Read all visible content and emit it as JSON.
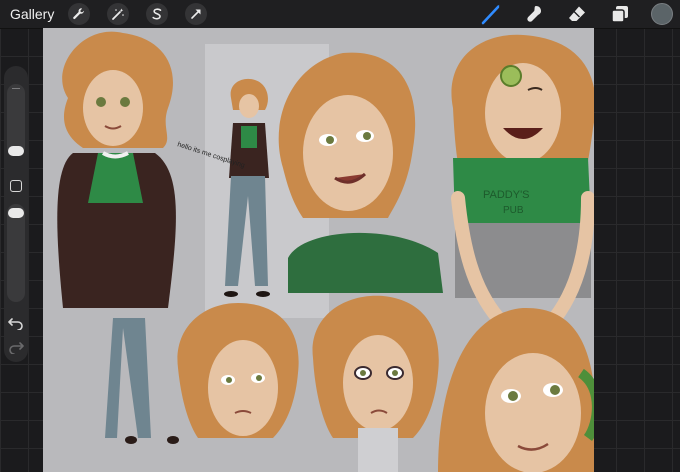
{
  "topbar": {
    "gallery_label": "Gallery",
    "left_tools": [
      {
        "icon": "wrench-icon"
      },
      {
        "icon": "magic-wand-icon"
      },
      {
        "icon": "selection-s-icon"
      },
      {
        "icon": "transform-arrow-icon"
      }
    ],
    "right_tools": [
      {
        "icon": "brush-icon",
        "active": true
      },
      {
        "icon": "smudge-icon"
      },
      {
        "icon": "eraser-icon"
      },
      {
        "icon": "layers-icon"
      }
    ],
    "current_color": "#5b6468"
  },
  "canvas": {
    "background": "#b9b9bc",
    "handwritten_note": "hello its me cosplaying"
  },
  "colors": {
    "hair": "#c98a4b",
    "skin": "#e6c4a4",
    "shirt": "#2e8a46",
    "jacket": "#3a2420",
    "jeans": "#6f8590"
  }
}
